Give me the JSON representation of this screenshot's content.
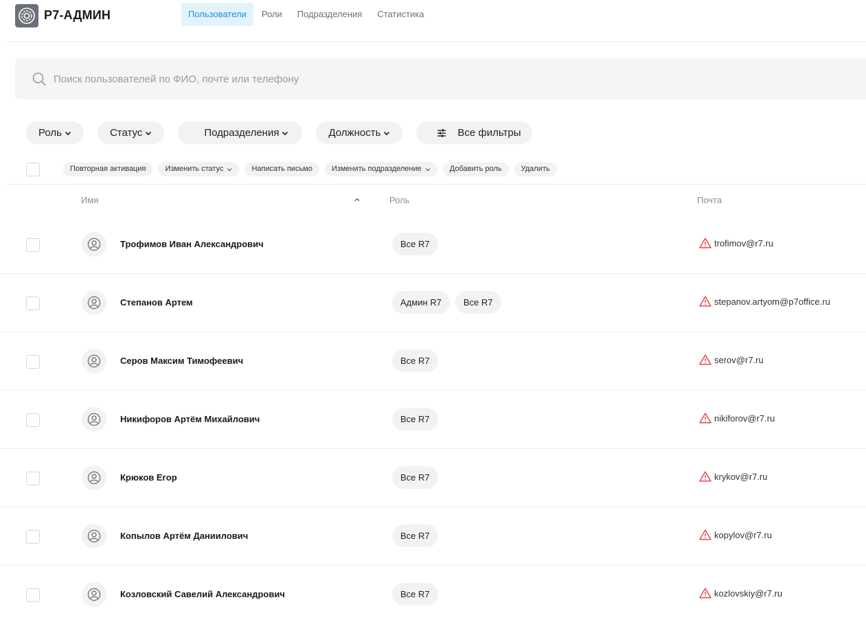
{
  "app": {
    "brand": "Р7-АДМИН"
  },
  "nav": {
    "tabs": [
      "Пользователи",
      "Роли",
      "Подразделения",
      "Статистика"
    ]
  },
  "search": {
    "placeholder": "Поиск пользователей по ФИО, почте или телефону",
    "value": ""
  },
  "filters": {
    "role": "Роль",
    "status": "Статус",
    "department": "Подразделения",
    "position": "Должность",
    "all": "Все фильтры"
  },
  "actions": {
    "reactivate": "Повторная активация",
    "change_status": "Изменить статус",
    "write_mail": "Написать письмо",
    "change_department": "Изменить подразделение",
    "add_role": "Добавить роль",
    "delete": "Удалить"
  },
  "table": {
    "columns": {
      "name": "Имя",
      "role": "Роль",
      "mail": "Почта"
    },
    "rows": [
      {
        "name": "Трофимов Иван Александрович",
        "roles": [
          "Все R7"
        ],
        "email": "trofimov@r7.ru"
      },
      {
        "name": "Степанов Артем",
        "roles": [
          "Админ R7",
          "Все R7"
        ],
        "email": "stepanov.artyom@p7office.ru"
      },
      {
        "name": "Серов Максим Тимофеевич",
        "roles": [
          "Все R7"
        ],
        "email": "serov@r7.ru"
      },
      {
        "name": "Никифоров Артём Михайлович",
        "roles": [
          "Все R7"
        ],
        "email": "nikiforov@r7.ru"
      },
      {
        "name": "Крюков Егор",
        "roles": [
          "Все R7"
        ],
        "email": "krykov@r7.ru"
      },
      {
        "name": "Копылов Артём Даниилович",
        "roles": [
          "Все R7"
        ],
        "email": "kopylov@r7.ru"
      },
      {
        "name": "Козловский Савелий Александрович",
        "roles": [
          "Все R7"
        ],
        "email": "kozlovskiy@r7.ru"
      }
    ]
  },
  "colors": {
    "accent": "#1d8fd1",
    "accent_bg": "#e3f3fd",
    "warning": "#e0393e",
    "chip_bg": "#f1f2f4"
  }
}
